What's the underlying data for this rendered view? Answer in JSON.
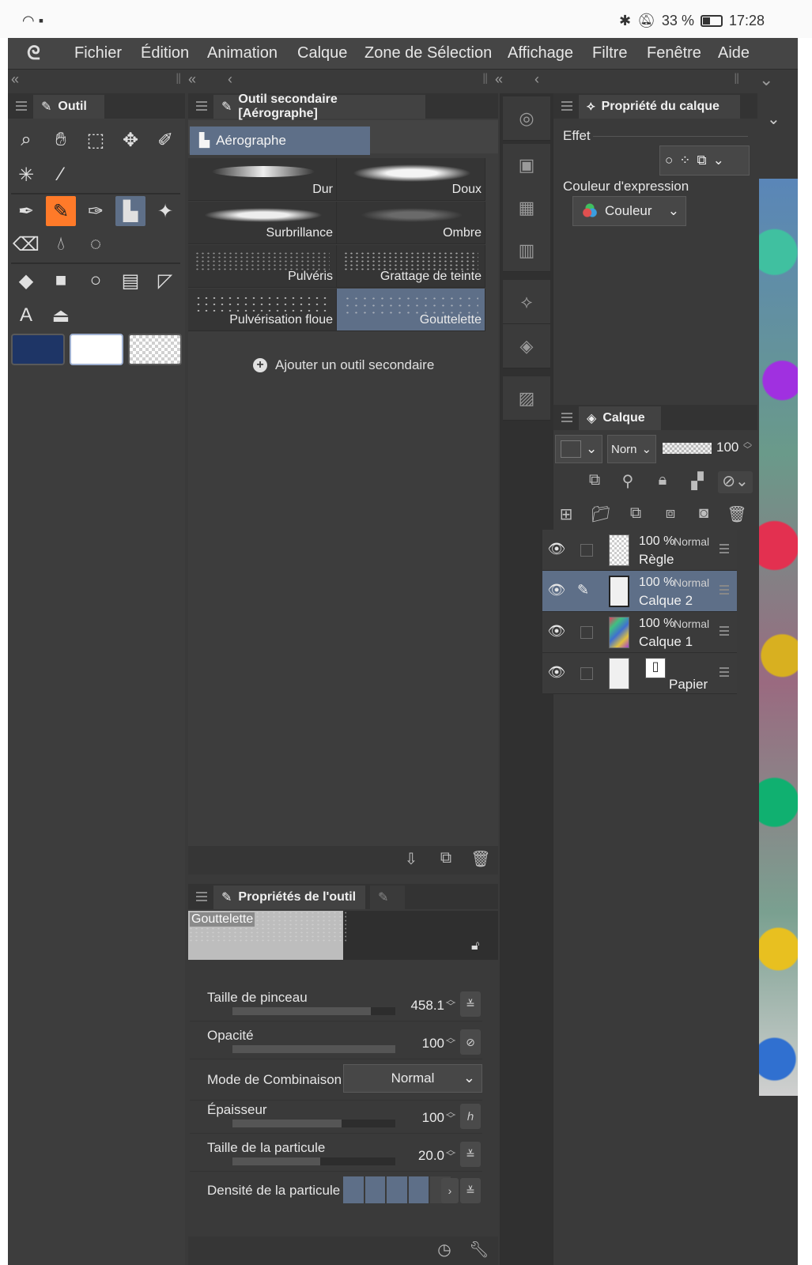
{
  "status_bar": {
    "battery_percent": "33 %",
    "time": "17:28"
  },
  "menu": {
    "items": [
      "Fichier",
      "Édition",
      "Animation",
      "Calque",
      "Zone de Sélection",
      "Affichage",
      "Filtre",
      "Fenêtre",
      "Aide"
    ]
  },
  "tool_panel": {
    "tab_label": "Outil",
    "colors": {
      "main": "#1e3566",
      "sub": "#ffffff",
      "transparent": "checker"
    }
  },
  "subtool_panel": {
    "tab_label": "Outil secondaire [Aérographe]",
    "group_label": "Aérographe",
    "brushes": [
      {
        "label": "Dur"
      },
      {
        "label": "Doux"
      },
      {
        "label": "Surbrillance"
      },
      {
        "label": "Ombre"
      },
      {
        "label": "Pulvéris"
      },
      {
        "label": "Grattage de teinte"
      },
      {
        "label": "Pulvérisation floue"
      },
      {
        "label": "Gouttelette"
      }
    ],
    "selected_brush": "Gouttelette",
    "add_label": "Ajouter un outil secondaire"
  },
  "tool_properties": {
    "tab_label": "Propriétés de l'outil",
    "preview_label": "Gouttelette",
    "rows": [
      {
        "name": "Taille de pinceau",
        "value": "458.1",
        "fill": 0.85
      },
      {
        "name": "Opacité",
        "value": "100",
        "fill": 1.0
      },
      {
        "name": "Épaisseur",
        "value": "100",
        "fill": 0.67
      },
      {
        "name": "Taille de la particule",
        "value": "20.0",
        "fill": 0.54
      }
    ],
    "blend_mode_label": "Mode de Combinaison",
    "blend_mode_value": "Normal",
    "density_label": "Densité de la particule",
    "density_level": 4,
    "density_max": 5
  },
  "layer_property": {
    "tab_label": "Propriété du calque",
    "effect_label": "Effet",
    "expression_label": "Couleur d'expression",
    "expression_value": "Couleur"
  },
  "layer_panel": {
    "tab_label": "Calque",
    "blend_short": "Norn",
    "opacity": "100",
    "layers": [
      {
        "percent": "100 %",
        "mode": "Normal",
        "name": "Règle"
      },
      {
        "percent": "100 %",
        "mode": "Normal",
        "name": "Calque 2"
      },
      {
        "percent": "100 %",
        "mode": "Normal",
        "name": "Calque 1"
      },
      {
        "percent": "",
        "mode": "",
        "name": "Papier"
      }
    ]
  },
  "colors": {
    "accent_orange": "#ff7a29",
    "selection_blue": "#5e6f88",
    "panel_bg": "#3d3d3d"
  }
}
